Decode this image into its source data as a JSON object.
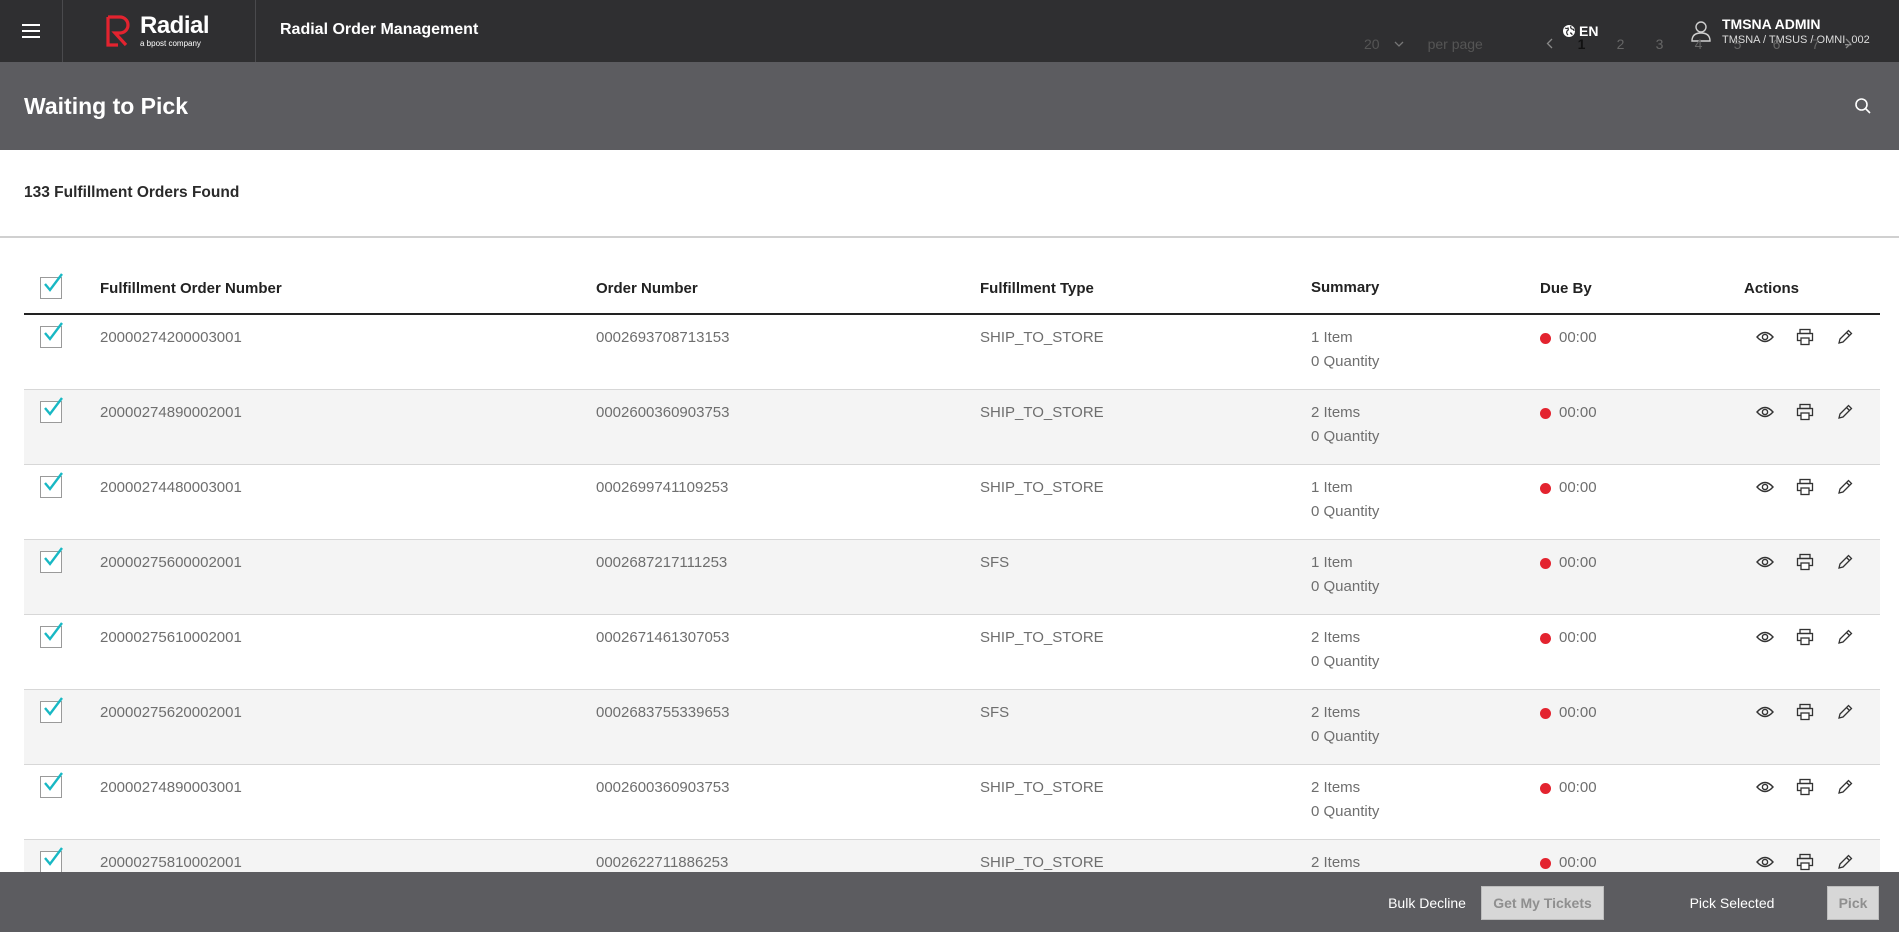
{
  "header": {
    "logo_brand": "Radial",
    "logo_tagline": "a bpost company",
    "app_title": "Radial Order Management",
    "language": "EN",
    "user_name": "TMSNA ADMIN",
    "user_path": "TMSNA / TMSUS / OMNI_002"
  },
  "page": {
    "title": "Waiting to Pick"
  },
  "results": {
    "count_text": "133 Fulfillment Orders Found",
    "per_page_value": "20",
    "per_page_label": "per page",
    "pages": [
      "1",
      "2",
      "3",
      "4",
      "5",
      "6",
      "7"
    ],
    "active_page": "1"
  },
  "table": {
    "columns": [
      "Fulfillment Order Number",
      "Order Number",
      "Fulfillment Type",
      "Summary",
      "Due By",
      "Actions"
    ],
    "rows": [
      {
        "fon": "20000274200003001",
        "on": "0002693708713153",
        "type": "SHIP_TO_STORE",
        "items": "1 Item",
        "qty": "0 Quantity",
        "due": "00:00"
      },
      {
        "fon": "20000274890002001",
        "on": "0002600360903753",
        "type": "SHIP_TO_STORE",
        "items": "2 Items",
        "qty": "0 Quantity",
        "due": "00:00"
      },
      {
        "fon": "20000274480003001",
        "on": "0002699741109253",
        "type": "SHIP_TO_STORE",
        "items": "1 Item",
        "qty": "0 Quantity",
        "due": "00:00"
      },
      {
        "fon": "20000275600002001",
        "on": "0002687217111253",
        "type": "SFS",
        "items": "1 Item",
        "qty": "0 Quantity",
        "due": "00:00"
      },
      {
        "fon": "20000275610002001",
        "on": "0002671461307053",
        "type": "SHIP_TO_STORE",
        "items": "2 Items",
        "qty": "0 Quantity",
        "due": "00:00"
      },
      {
        "fon": "20000275620002001",
        "on": "0002683755339653",
        "type": "SFS",
        "items": "2 Items",
        "qty": "0 Quantity",
        "due": "00:00"
      },
      {
        "fon": "20000274890003001",
        "on": "0002600360903753",
        "type": "SHIP_TO_STORE",
        "items": "2 Items",
        "qty": "0 Quantity",
        "due": "00:00"
      },
      {
        "fon": "20000275810002001",
        "on": "0002622711886253",
        "type": "SHIP_TO_STORE",
        "items": "2 Items",
        "qty": "",
        "due": "00:00"
      }
    ]
  },
  "footer": {
    "bulk_decline": "Bulk Decline",
    "get_my_tickets": "Get My Tickets",
    "pick_selected": "Pick Selected",
    "pick": "Pick"
  },
  "colors": {
    "topbar": "#2f2f31",
    "header": "#5c5c60",
    "brand_red": "#e3232f",
    "check_teal": "#18b8c4",
    "due_dot": "#e3232f"
  },
  "icons": {
    "menu": "hamburger-icon",
    "language": "globe-icon",
    "user": "user-icon",
    "search": "search-icon",
    "view": "eye-icon",
    "print": "printer-icon",
    "edit": "pencil-icon"
  }
}
